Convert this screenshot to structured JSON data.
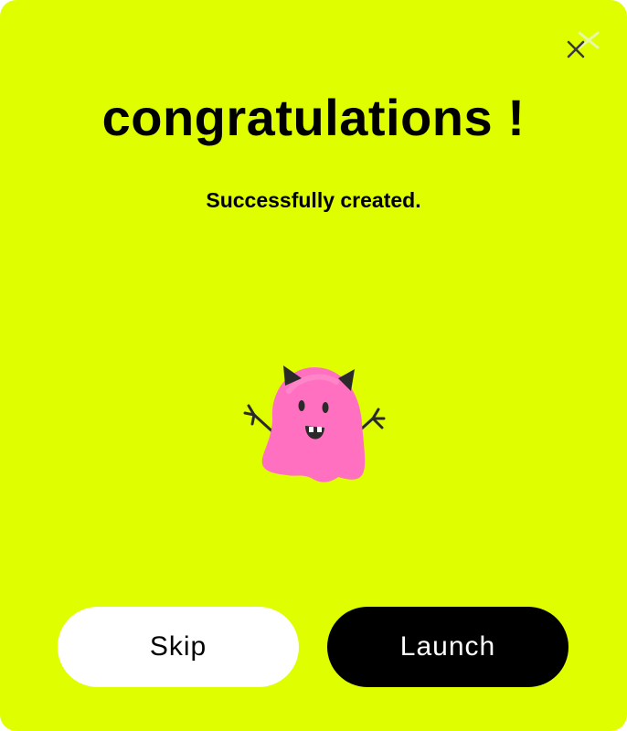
{
  "dialog": {
    "background_color": "#dfff00",
    "title": "congratulations !",
    "subtitle": "Successfully created.",
    "close_icon": "close-icon",
    "mascot_icon": "pink-monster-mascot-icon"
  },
  "actions": {
    "skip_label": "Skip",
    "launch_label": "Launch"
  }
}
